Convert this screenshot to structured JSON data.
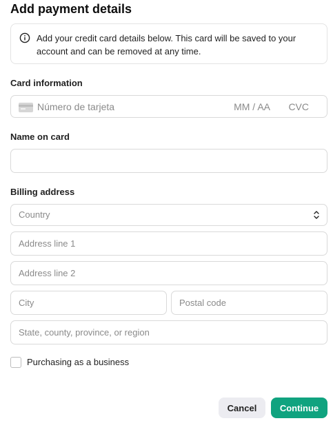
{
  "title": "Add payment details",
  "info": {
    "icon": "info-icon",
    "text": "Add your credit card details below. This card will be saved to your account and can be removed at any time."
  },
  "card": {
    "label": "Card information",
    "number_placeholder": "Número de tarjeta",
    "expiry_placeholder": "MM / AA",
    "cvc_placeholder": "CVC",
    "icon": "credit-card-icon"
  },
  "name_on_card": {
    "label": "Name on card",
    "value": ""
  },
  "billing": {
    "label": "Billing address",
    "country_placeholder": "Country",
    "address1_placeholder": "Address line 1",
    "address2_placeholder": "Address line 2",
    "city_placeholder": "City",
    "postal_placeholder": "Postal code",
    "state_placeholder": "State, county, province, or region"
  },
  "business": {
    "label": "Purchasing as a business",
    "checked": false
  },
  "buttons": {
    "cancel": "Cancel",
    "continue": "Continue"
  },
  "colors": {
    "accent": "#10a37f",
    "cancel_bg": "#ececf1",
    "border": "#d9d9d9"
  }
}
